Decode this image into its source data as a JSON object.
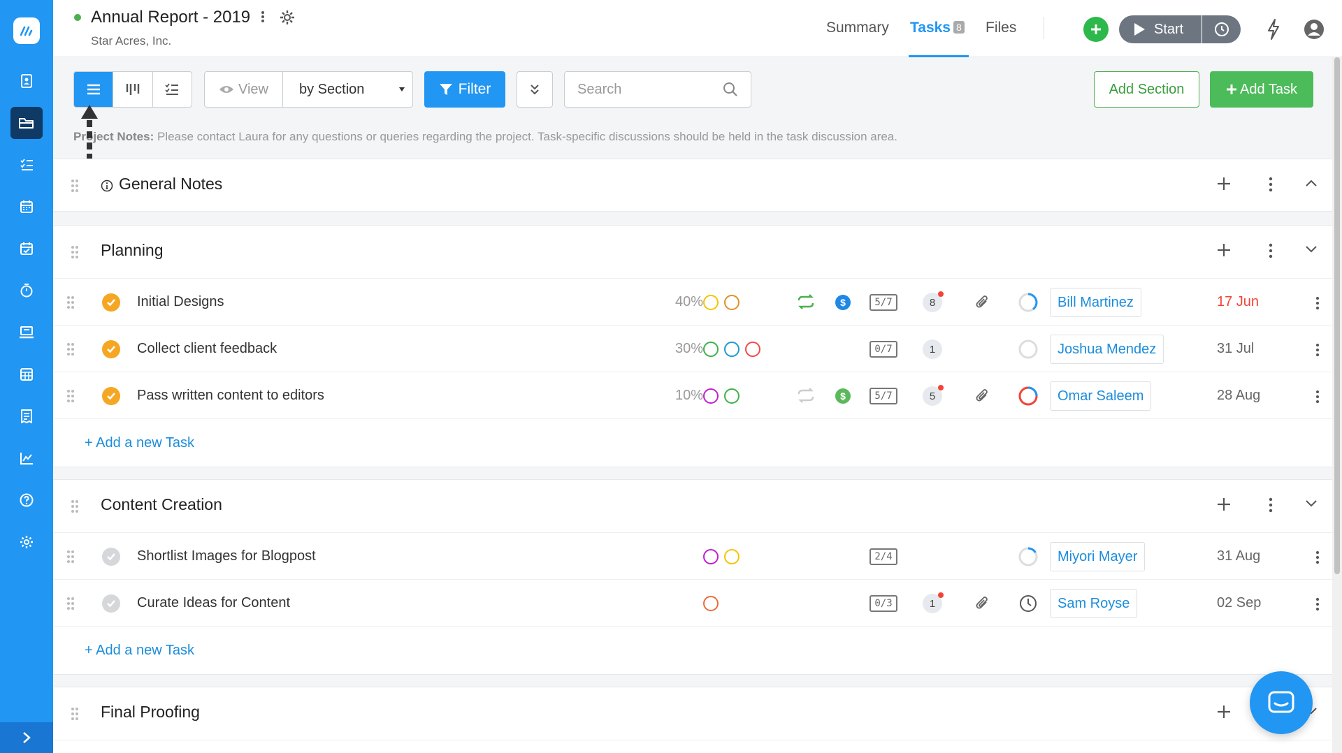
{
  "header": {
    "title": "Annual Report - 2019",
    "client": "Star Acres, Inc.",
    "tabs": [
      {
        "label": "Summary"
      },
      {
        "label": "Tasks",
        "badge": "8"
      },
      {
        "label": "Files"
      }
    ],
    "start_label": "Start"
  },
  "toolbar": {
    "view_label": "View",
    "group_by": "by Section",
    "filter_label": "Filter",
    "search_placeholder": "Search",
    "add_section": "Add Section",
    "add_task": "Add Task"
  },
  "project_notes": {
    "label": "Project Notes:",
    "text": "Please contact Laura for any questions or queries regarding the project. Task-specific discussions should be held in the task discussion area."
  },
  "sections": [
    {
      "title": "General Notes"
    },
    {
      "title": "Planning",
      "add_link": "+ Add a new Task",
      "tasks": [
        {
          "name": "Initial Designs",
          "percent": "40%",
          "subtasks": "5/7",
          "comments": "8",
          "assignee": "Bill Martinez",
          "due": "17 Jun"
        },
        {
          "name": "Collect client feedback",
          "percent": "30%",
          "subtasks": "0/7",
          "comments": "1",
          "assignee": "Joshua Mendez",
          "due": "31 Jul"
        },
        {
          "name": "Pass written content to editors",
          "percent": "10%",
          "subtasks": "5/7",
          "comments": "5",
          "assignee": "Omar Saleem",
          "due": "28 Aug"
        }
      ]
    },
    {
      "title": "Content Creation",
      "add_link": "+ Add a new Task",
      "tasks": [
        {
          "name": "Shortlist Images for Blogpost",
          "subtasks": "2/4",
          "assignee": "Miyori Mayer",
          "due": "31 Aug"
        },
        {
          "name": "Curate Ideas for Content",
          "subtasks": "0/3",
          "comments": "1",
          "assignee": "Sam Royse",
          "due": "02 Sep"
        }
      ]
    },
    {
      "title": "Final Proofing"
    }
  ],
  "colors": {
    "brand": "#2196f3",
    "success": "#4caf50",
    "check_done": "#f5a623",
    "overdue": "#f44336",
    "tag_yellow": "#f5c400",
    "tag_orange": "#e0902a",
    "tag_green": "#3fb24a",
    "tag_blue": "#1e9ad6",
    "tag_red": "#f44a4a",
    "tag_purple": "#c21fd1",
    "tag_orange_red": "#f06a3a"
  },
  "icons": [
    "dashboard-icon",
    "projects-icon",
    "tasks-icon",
    "calendar-icon",
    "schedule-icon",
    "timer-icon",
    "workload-icon",
    "spreadsheet-icon",
    "invoice-icon",
    "reports-icon",
    "help-icon",
    "settings-icon",
    "expand-sidebar-icon"
  ]
}
